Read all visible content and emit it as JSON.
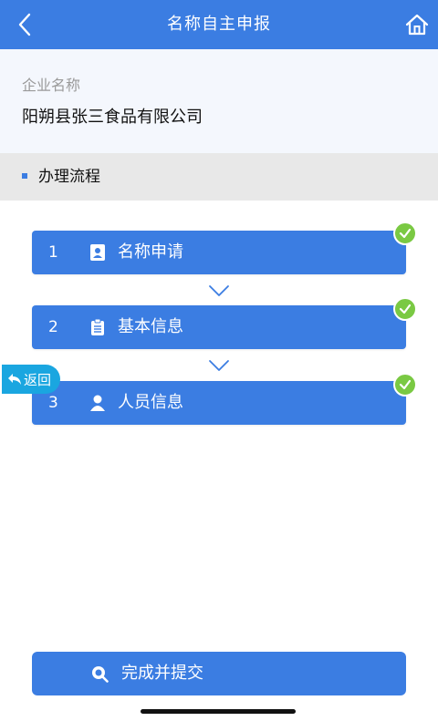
{
  "header": {
    "title": "名称自主申报",
    "back_icon": "chevron-left-icon",
    "home_icon": "home-icon"
  },
  "company": {
    "label": "企业名称",
    "value": "阳朔县张三食品有限公司"
  },
  "section": {
    "title": "办理流程"
  },
  "steps": [
    {
      "number": "1",
      "label": "名称申请",
      "icon": "id-card-icon",
      "completed": true
    },
    {
      "number": "2",
      "label": "基本信息",
      "icon": "clipboard-icon",
      "completed": true
    },
    {
      "number": "3",
      "label": "人员信息",
      "icon": "person-icon",
      "completed": true
    }
  ],
  "floating_back": {
    "label": "返回"
  },
  "submit": {
    "label": "完成并提交",
    "icon": "search-icon"
  },
  "colors": {
    "primary": "#3b7de2",
    "check": "#7ac943",
    "badge": "#1aa6e0"
  }
}
